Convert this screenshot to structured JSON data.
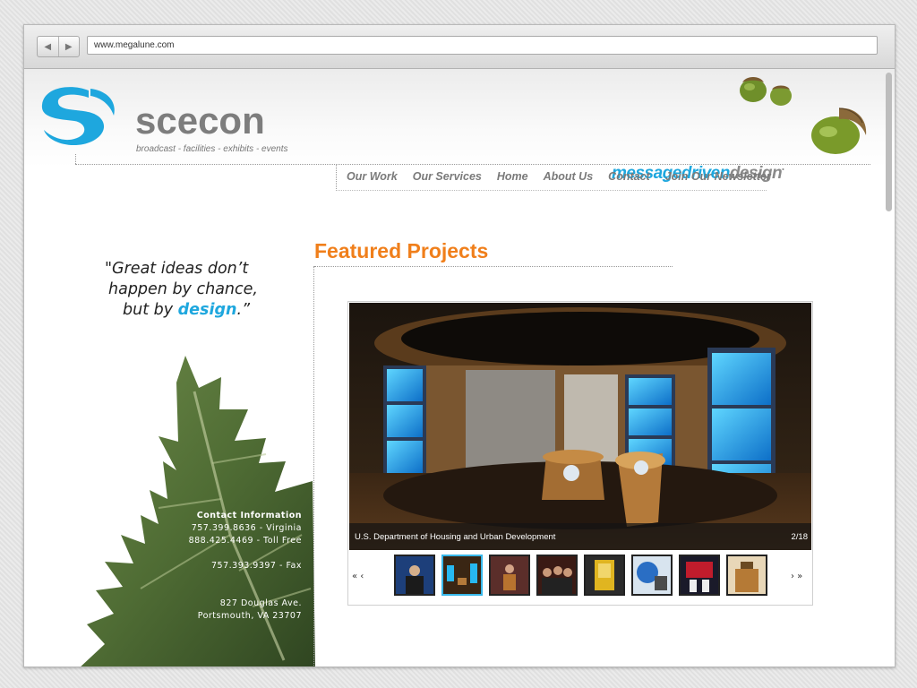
{
  "browser": {
    "back_glyph": "◀",
    "forward_glyph": "▶",
    "url": "www.megalune.com"
  },
  "header": {
    "brand": "scecon",
    "tagline": "broadcast - facilities - exhibits - events",
    "slogan_part1": "messagedriven",
    "slogan_part2": "design",
    "slogan_mark": "•"
  },
  "nav": {
    "items": [
      {
        "label": "Our Work"
      },
      {
        "label": "Our Services"
      },
      {
        "label": "Home"
      },
      {
        "label": "About Us"
      },
      {
        "label": "Contact"
      },
      {
        "label": "Join Our Newsletter"
      }
    ]
  },
  "quote": {
    "line1": "\"Great ideas don’t",
    "line2": "happen by chance,",
    "line3_pre": "but by ",
    "line3_em": "design",
    "line3_post": ".”"
  },
  "contact": {
    "heading": "Contact Information",
    "phone_virginia": "757.399.8636 - Virginia",
    "phone_tollfree": "888.425.4469 - Toll Free",
    "fax": "757.393.9397 - Fax",
    "address1": "827 Douglas Ave.",
    "address2": "Portsmouth, VA 23707"
  },
  "featured": {
    "title": "Featured Projects",
    "caption": "U.S. Department of Housing and Urban Development",
    "counter": "2/18",
    "prev": "«  ‹",
    "next": "›  »",
    "thumbnail_count": 8,
    "selected_index": 1
  },
  "colors": {
    "accent_blue": "#1ea7de",
    "accent_orange": "#f07f1b",
    "brand_gray": "#7d7d7d"
  }
}
